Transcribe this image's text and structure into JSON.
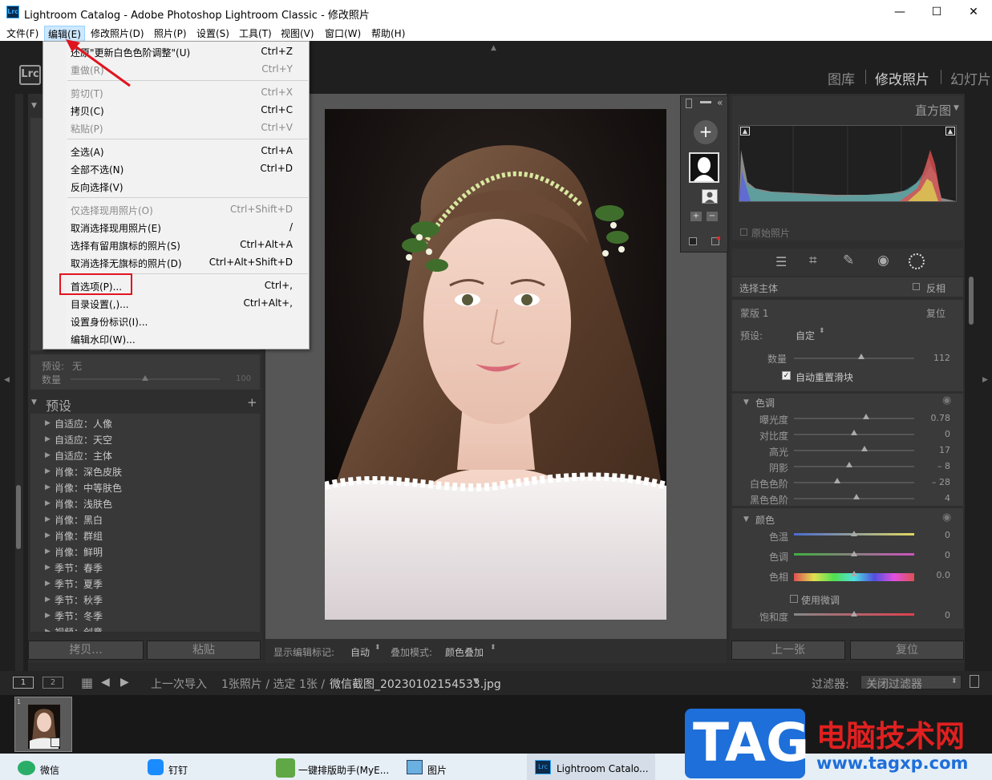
{
  "window": {
    "title": "Lightroom Catalog - Adobe Photoshop Lightroom Classic - 修改照片",
    "app_icon": "Lrc",
    "controls": {
      "minimize": "—",
      "maximize": "☐",
      "close": "✕"
    }
  },
  "menubar": {
    "items": [
      "文件(F)",
      "编辑(E)",
      "修改照片(D)",
      "照片(P)",
      "设置(S)",
      "工具(T)",
      "视图(V)",
      "窗口(W)",
      "帮助(H)"
    ],
    "active": "编辑(E)"
  },
  "edit_menu": {
    "items": [
      {
        "label": "还原\"更新白色色阶调整\"(U)",
        "shortcut": "Ctrl+Z",
        "enabled": true
      },
      {
        "label": "重做(R)",
        "shortcut": "Ctrl+Y",
        "enabled": false
      },
      {
        "label": "剪切(T)",
        "shortcut": "Ctrl+X",
        "enabled": false
      },
      {
        "label": "拷贝(C)",
        "shortcut": "Ctrl+C",
        "enabled": true
      },
      {
        "label": "粘贴(P)",
        "shortcut": "Ctrl+V",
        "enabled": false
      },
      {
        "label": "全选(A)",
        "shortcut": "Ctrl+A",
        "enabled": true
      },
      {
        "label": "全部不选(N)",
        "shortcut": "Ctrl+D",
        "enabled": true
      },
      {
        "label": "反向选择(V)",
        "shortcut": "",
        "enabled": true
      },
      {
        "label": "仅选择现用照片(O)",
        "shortcut": "Ctrl+Shift+D",
        "enabled": false
      },
      {
        "label": "取消选择现用照片(E)",
        "shortcut": "/",
        "enabled": true
      },
      {
        "label": "选择有留用旗标的照片(S)",
        "shortcut": "Ctrl+Alt+A",
        "enabled": true
      },
      {
        "label": "取消选择无旗标的照片(D)",
        "shortcut": "Ctrl+Alt+Shift+D",
        "enabled": true
      },
      {
        "label": "首选项(P)...",
        "shortcut": "Ctrl+,",
        "enabled": true
      },
      {
        "label": "目录设置(,)...",
        "shortcut": "Ctrl+Alt+,",
        "enabled": true
      },
      {
        "label": "设置身份标识(I)...",
        "shortcut": "",
        "enabled": true
      },
      {
        "label": "编辑水印(W)...",
        "shortcut": "",
        "enabled": true
      }
    ]
  },
  "modules": [
    "图库",
    "修改照片",
    "幻灯片"
  ],
  "left_panel": {
    "preset_label": "预设:",
    "preset_value": "无",
    "amount_label": "数量",
    "amount_value": "100",
    "presets_title": "预设",
    "presets": [
      "自适应：人像",
      "自适应：天空",
      "自适应：主体",
      "肖像：深色皮肤",
      "肖像：中等肤色",
      "肖像：浅肤色",
      "肖像：黑白",
      "肖像：群组",
      "肖像：鲜明",
      "季节：春季",
      "季节：夏季",
      "季节：秋季",
      "季节：冬季",
      "视频：创意"
    ],
    "copy_button": "拷贝...",
    "paste_button": "粘贴"
  },
  "toolbar": {
    "show_edit_pins_label": "显示编辑标记:",
    "show_edit_pins_value": "自动",
    "overlay_mode_label": "叠加模式:",
    "overlay_mode_value": "颜色叠加"
  },
  "right_panel": {
    "histogram_title": "直方图",
    "original_photo": "原始照片",
    "select_subject": "选择主体",
    "invert": "反相",
    "mask_name": "蒙版 1",
    "reset": "复位",
    "preset_label": "预设:",
    "preset_value": "自定",
    "amount_label": "数量",
    "amount_value": 112,
    "auto_reset_sliders": "自动重置滑块",
    "tone_section": "色调",
    "tone": [
      {
        "label": "曝光度",
        "value": "0.78"
      },
      {
        "label": "对比度",
        "value": "0"
      },
      {
        "label": "高光",
        "value": "17"
      },
      {
        "label": "阴影",
        "value": "– 8"
      },
      {
        "label": "白色色阶",
        "value": "– 28"
      },
      {
        "label": "黑色色阶",
        "value": "4"
      }
    ],
    "color_section": "颜色",
    "color": [
      {
        "label": "色温",
        "value": "0"
      },
      {
        "label": "色调",
        "value": "0"
      },
      {
        "label": "色相",
        "value": "0.0"
      }
    ],
    "use_fine_adjust": "使用微调",
    "saturation_label": "饱和度",
    "saturation_value": "0",
    "prev_button": "上一张",
    "reset_button": "复位"
  },
  "filmstrip": {
    "view1": "1",
    "view2": "2",
    "source": "上一次导入",
    "count": "1张照片 / 选定 1张 /",
    "filename": "微信截图_20230102154533.jpg",
    "filter_label": "过滤器:",
    "filter_value": "关闭过滤器"
  },
  "taskbar": {
    "items": [
      "微信",
      "钉钉",
      "一键排版助手(MyE...",
      "图片",
      "Lightroom Catalo..."
    ]
  },
  "watermark": {
    "tag": "TAG",
    "name": "电脑技术网",
    "url": "www.tagxp.com"
  }
}
